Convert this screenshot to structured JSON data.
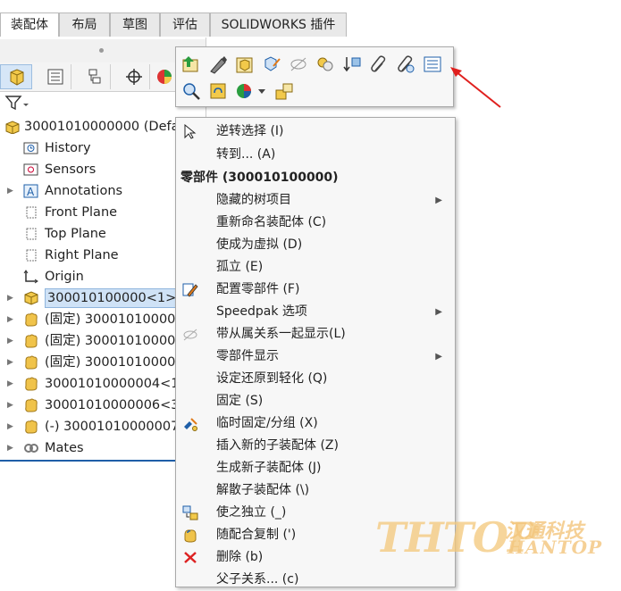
{
  "tabs": [
    "装配体",
    "布局",
    "草图",
    "评估",
    "SOLIDWORKS 插件"
  ],
  "tree": {
    "root": "30001010000000  (Defa",
    "items": [
      {
        "label": "History",
        "icon": "history-icon",
        "expandable": false
      },
      {
        "label": "Sensors",
        "icon": "sensors-icon",
        "expandable": false
      },
      {
        "label": "Annotations",
        "icon": "annotations-icon",
        "expandable": true
      },
      {
        "label": "Front Plane",
        "icon": "plane-icon",
        "expandable": false
      },
      {
        "label": "Top Plane",
        "icon": "plane-icon",
        "expandable": false
      },
      {
        "label": "Right Plane",
        "icon": "plane-icon",
        "expandable": false
      },
      {
        "label": "Origin",
        "icon": "origin-icon",
        "expandable": false
      },
      {
        "label": "300010100000<1> (",
        "icon": "part-icon",
        "expandable": true,
        "selected": true
      },
      {
        "label": "(固定) 300010100000",
        "icon": "part-icon",
        "expandable": true
      },
      {
        "label": "(固定) 300010100000",
        "icon": "part-icon",
        "expandable": true
      },
      {
        "label": "(固定) 300010100000",
        "icon": "part-icon",
        "expandable": true
      },
      {
        "label": "30001010000004<1",
        "icon": "part-icon",
        "expandable": true
      },
      {
        "label": "30001010000006<3",
        "icon": "part-icon",
        "expandable": true
      },
      {
        "label": "(-) 30001010000007",
        "icon": "part-icon",
        "expandable": true
      },
      {
        "label": "Mates",
        "icon": "mates-icon",
        "expandable": true
      }
    ]
  },
  "context_menu": {
    "top_items": [
      "逆转选择 (I)",
      "转到... (A)"
    ],
    "header": "零部件 (300010100000)",
    "items": [
      {
        "label": "隐藏的树项目",
        "submenu": true,
        "icon": ""
      },
      {
        "label": "重新命名装配体 (C)",
        "submenu": false,
        "icon": ""
      },
      {
        "label": "使成为虚拟 (D)",
        "submenu": false,
        "icon": ""
      },
      {
        "label": "孤立 (E)",
        "submenu": false,
        "icon": ""
      },
      {
        "label": "配置零部件 (F)",
        "submenu": false,
        "icon": "configure-icon"
      },
      {
        "label": "Speedpak 选项",
        "submenu": true,
        "icon": ""
      },
      {
        "label": "带从属关系一起显示(L)",
        "submenu": false,
        "icon": "show-with-dependents-icon"
      },
      {
        "label": "零部件显示",
        "submenu": true,
        "icon": ""
      },
      {
        "label": "设定还原到轻化 (Q)",
        "submenu": false,
        "icon": ""
      },
      {
        "label": "固定 (S)",
        "submenu": false,
        "icon": ""
      },
      {
        "label": "临时固定/分组 (X)",
        "submenu": false,
        "icon": "temp-fix-icon"
      },
      {
        "label": "插入新的子装配体 (Z)",
        "submenu": false,
        "icon": ""
      },
      {
        "label": "生成新子装配体 (J)",
        "submenu": false,
        "icon": ""
      },
      {
        "label": "解散子装配体 (\\)",
        "submenu": false,
        "icon": ""
      },
      {
        "label": "使之独立 (_)",
        "submenu": false,
        "icon": "make-independent-icon"
      },
      {
        "label": "随配合复制 (')",
        "submenu": false,
        "icon": "copy-with-mates-icon"
      },
      {
        "label": "删除 (b)",
        "submenu": false,
        "icon": "delete-icon"
      },
      {
        "label": "父子关系... (c)",
        "submenu": false,
        "icon": ""
      }
    ]
  },
  "watermark": {
    "main": "THTOP",
    "cn": "汉通科技",
    "en": "HANTOP"
  },
  "colors": {
    "accent": "#1f5fa8",
    "selection": "#cfe2f6",
    "arrow": "#e0201e"
  }
}
